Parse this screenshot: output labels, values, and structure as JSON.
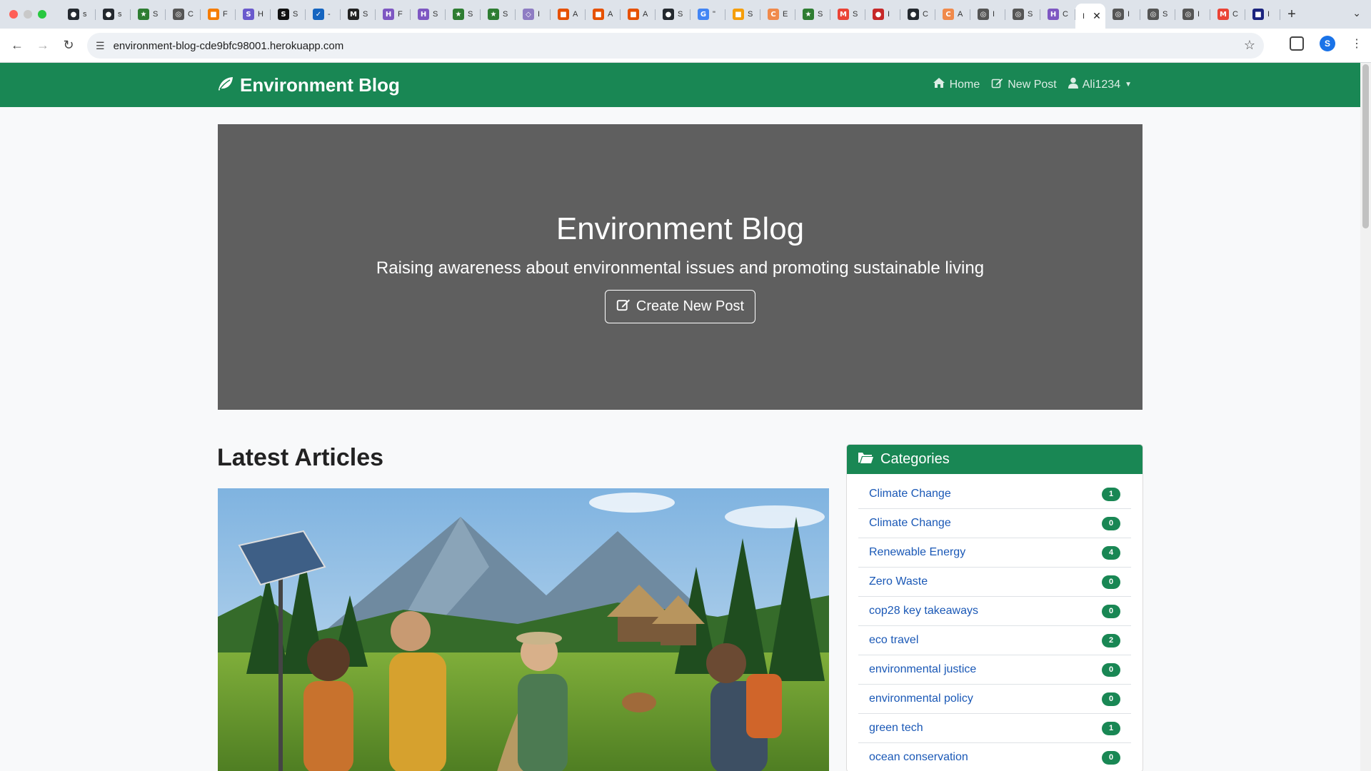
{
  "browser": {
    "tabs": [
      {
        "icon": "github-icon",
        "title": "s",
        "color": "#24292f",
        "glyph": "●"
      },
      {
        "icon": "github-icon",
        "title": "s",
        "color": "#24292f",
        "glyph": "●"
      },
      {
        "icon": "star-icon",
        "title": "S",
        "color": "#2e7d32",
        "glyph": "★"
      },
      {
        "icon": "globe-icon",
        "title": "C",
        "color": "#555555",
        "glyph": "◎"
      },
      {
        "icon": "orange-app-icon",
        "title": "F",
        "color": "#f57c00",
        "glyph": "■"
      },
      {
        "icon": "s-app-icon",
        "title": "H",
        "color": "#6a5acd",
        "glyph": "S"
      },
      {
        "icon": "s-dark-icon",
        "title": "S",
        "color": "#111111",
        "glyph": "S"
      },
      {
        "icon": "check-icon",
        "title": "-",
        "color": "#1565c0",
        "glyph": "✓"
      },
      {
        "icon": "m-app-icon",
        "title": "S",
        "color": "#222222",
        "glyph": "M"
      },
      {
        "icon": "h-app-icon",
        "title": "F",
        "color": "#7e57c2",
        "glyph": "H"
      },
      {
        "icon": "h-app-icon",
        "title": "S",
        "color": "#7e57c2",
        "glyph": "H"
      },
      {
        "icon": "star-icon",
        "title": "S",
        "color": "#2e7d32",
        "glyph": "★"
      },
      {
        "icon": "star-icon",
        "title": "S",
        "color": "#2e7d32",
        "glyph": "★"
      },
      {
        "icon": "cube-icon",
        "title": "I",
        "color": "#8e7cc3",
        "glyph": "◇"
      },
      {
        "icon": "box-icon",
        "title": "A",
        "color": "#e65100",
        "glyph": "■"
      },
      {
        "icon": "box-icon",
        "title": "A",
        "color": "#e65100",
        "glyph": "■"
      },
      {
        "icon": "box-icon",
        "title": "A",
        "color": "#e65100",
        "glyph": "■"
      },
      {
        "icon": "github-icon",
        "title": "S",
        "color": "#24292f",
        "glyph": "●"
      },
      {
        "icon": "google-icon",
        "title": "\"",
        "color": "#4285f4",
        "glyph": "G"
      },
      {
        "icon": "orange-app-icon",
        "title": "S",
        "color": "#f59e0b",
        "glyph": "■"
      },
      {
        "icon": "c-app-icon",
        "title": "E",
        "color": "#f08a4b",
        "glyph": "C"
      },
      {
        "icon": "star-icon",
        "title": "S",
        "color": "#2e7d32",
        "glyph": "★"
      },
      {
        "icon": "gmail-icon",
        "title": "S",
        "color": "#ea4335",
        "glyph": "M"
      },
      {
        "icon": "red-circle-icon",
        "title": "I",
        "color": "#c62828",
        "glyph": "●"
      },
      {
        "icon": "github-icon",
        "title": "C",
        "color": "#24292f",
        "glyph": "●"
      },
      {
        "icon": "c-app-icon",
        "title": "A",
        "color": "#f08a4b",
        "glyph": "C"
      },
      {
        "icon": "globe-icon",
        "title": "I",
        "color": "#555555",
        "glyph": "◎"
      },
      {
        "icon": "globe-icon",
        "title": "S",
        "color": "#555555",
        "glyph": "◎"
      },
      {
        "icon": "h-app-icon",
        "title": "C",
        "color": "#7e57c2",
        "glyph": "H"
      }
    ],
    "active_tab": {
      "title": "I"
    },
    "after_tabs": [
      {
        "icon": "globe-icon",
        "title": "I",
        "color": "#555555",
        "glyph": "◎"
      },
      {
        "icon": "globe-icon",
        "title": "S",
        "color": "#555555",
        "glyph": "◎"
      },
      {
        "icon": "globe-icon",
        "title": "I",
        "color": "#555555",
        "glyph": "◎"
      },
      {
        "icon": "gmail-icon",
        "title": "C",
        "color": "#ea4335",
        "glyph": "M"
      },
      {
        "icon": "blue-app-icon",
        "title": "I",
        "color": "#1a237e",
        "glyph": "■"
      }
    ],
    "url": "environment-blog-cde9bfc98001.herokuapp.com",
    "profile_initial": "S"
  },
  "navbar": {
    "brand": "Environment Blog",
    "links": [
      {
        "icon": "home-icon",
        "label": "Home"
      },
      {
        "icon": "edit-icon",
        "label": "New Post"
      },
      {
        "icon": "user-icon",
        "label": "Ali1234"
      }
    ]
  },
  "hero": {
    "title": "Environment Blog",
    "subtitle": "Raising awareness about environmental issues and promoting sustainable living",
    "button": "Create New Post"
  },
  "main": {
    "section_title": "Latest Articles"
  },
  "sidebar": {
    "title": "Categories",
    "categories": [
      {
        "label": "Climate Change",
        "count": "1"
      },
      {
        "label": "Climate Change",
        "count": "0"
      },
      {
        "label": "Renewable Energy",
        "count": "4"
      },
      {
        "label": "Zero Waste",
        "count": "0"
      },
      {
        "label": "cop28 key takeaways",
        "count": "0"
      },
      {
        "label": "eco travel",
        "count": "2"
      },
      {
        "label": "environmental justice",
        "count": "0"
      },
      {
        "label": "environmental policy",
        "count": "0"
      },
      {
        "label": "green tech",
        "count": "1"
      },
      {
        "label": "ocean conservation",
        "count": "0"
      }
    ]
  },
  "colors": {
    "brand_green": "#198754",
    "hero_gray": "#5f5f5f",
    "link_blue": "#1a58b6"
  }
}
